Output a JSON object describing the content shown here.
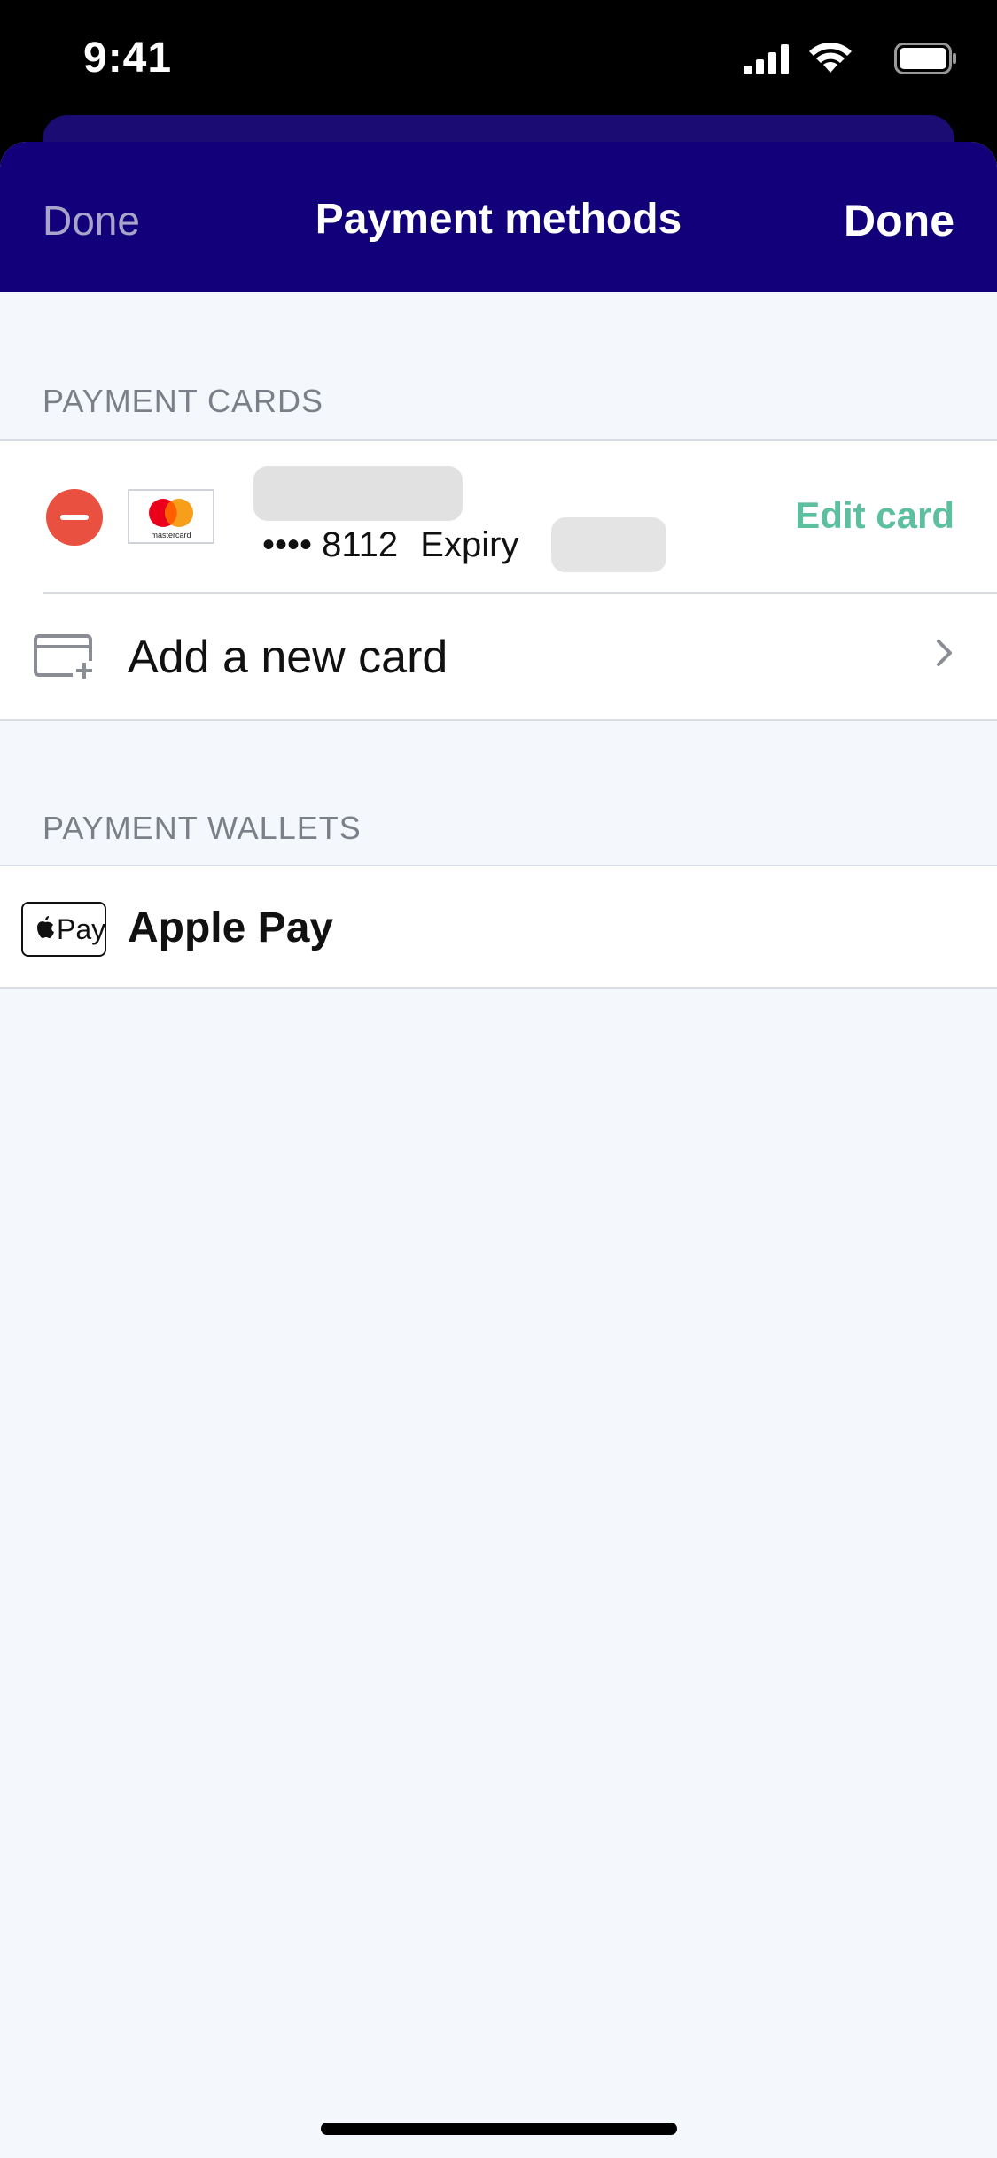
{
  "status_bar": {
    "time": "9:41"
  },
  "nav": {
    "left_label": "Done",
    "title": "Payment methods",
    "right_label": "Done"
  },
  "payment_cards": {
    "header": "PAYMENT CARDS",
    "card": {
      "brand_icon": "mastercard-logo",
      "brand_text": "mastercard",
      "number": "•••• 8112",
      "expiry_label": "Expiry",
      "edit_label": "Edit card"
    },
    "add_card_label": "Add a new card"
  },
  "payment_wallets": {
    "header": "PAYMENT WALLETS",
    "apple_pay_badge_text": "Pay",
    "apple_pay_label": "Apple Pay"
  },
  "colors": {
    "nav_background": "#12007a",
    "accent_green": "#5bbfa0",
    "remove_red": "#e9503f",
    "page_background": "#f4f7fb"
  }
}
